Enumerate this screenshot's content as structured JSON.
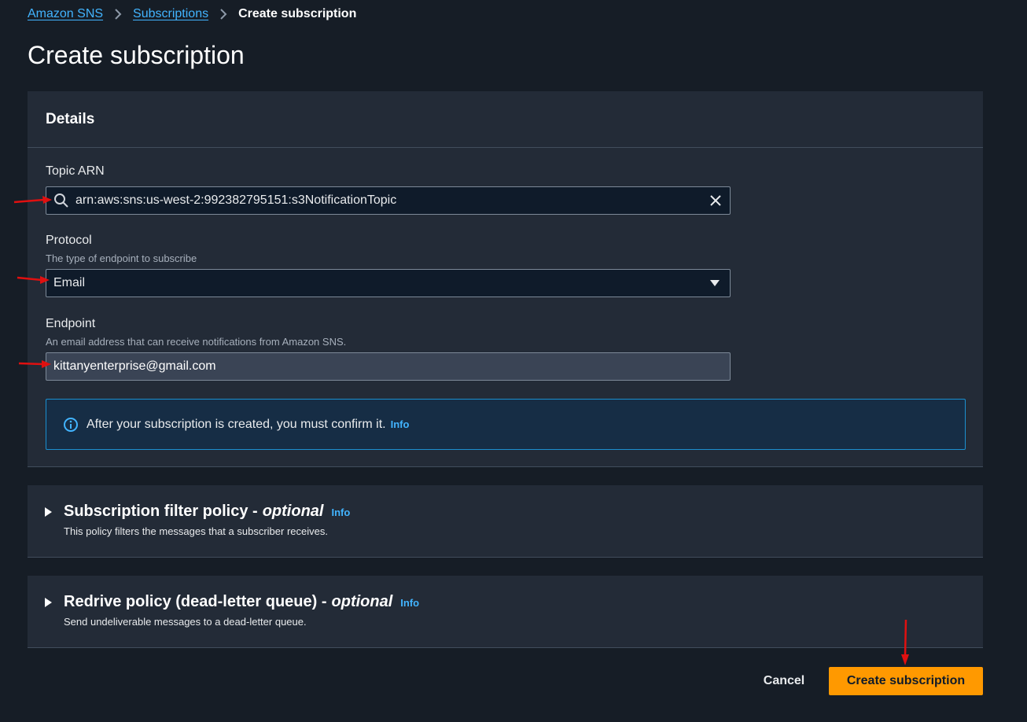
{
  "breadcrumb": {
    "items": [
      "Amazon SNS",
      "Subscriptions"
    ],
    "current": "Create subscription"
  },
  "page": {
    "title": "Create subscription"
  },
  "details": {
    "header": "Details",
    "topic_arn": {
      "label": "Topic ARN",
      "value": "arn:aws:sns:us-west-2:992382795151:s3NotificationTopic"
    },
    "protocol": {
      "label": "Protocol",
      "description": "The type of endpoint to subscribe",
      "value": "Email"
    },
    "endpoint": {
      "label": "Endpoint",
      "description": "An email address that can receive notifications from Amazon SNS.",
      "value": "kittanyenterprise@gmail.com"
    },
    "alert": {
      "text": "After your subscription is created, you must confirm it.",
      "link": "Info"
    }
  },
  "filter_policy": {
    "title": "Subscription filter policy -",
    "optional": "optional",
    "info": "Info",
    "description": "This policy filters the messages that a subscriber receives."
  },
  "redrive_policy": {
    "title": "Redrive policy (dead-letter queue) -",
    "optional": "optional",
    "info": "Info",
    "description": "Send undeliverable messages to a dead-letter queue."
  },
  "actions": {
    "cancel": "Cancel",
    "create": "Create subscription"
  },
  "colors": {
    "background": "#161d26",
    "panel": "#232b37",
    "link": "#42b4ff",
    "primary_button": "#ff9900",
    "annotation_arrow": "#e01010"
  },
  "icons": [
    "search-icon",
    "close-icon",
    "caret-down-icon",
    "info-circle-icon",
    "expand-caret-icon",
    "chevron-right-icon",
    "annotation-arrow-icon"
  ]
}
